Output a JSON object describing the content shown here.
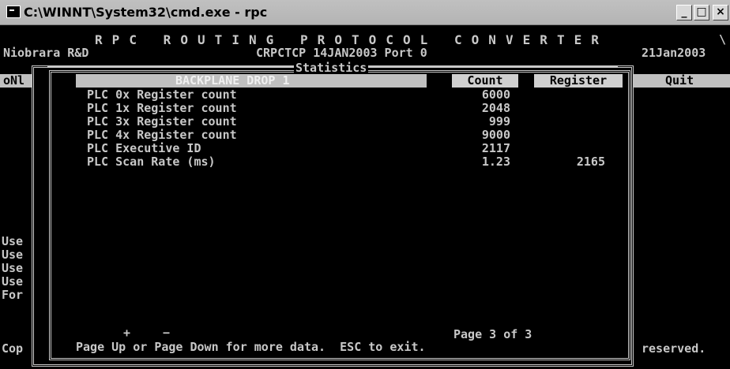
{
  "window": {
    "title": "C:\\WINNT\\System32\\cmd.exe - rpc",
    "minimize_label": "_",
    "maximize_label": "□",
    "close_label": "×"
  },
  "header": {
    "title": "R P C   R O U T I N G   P R O T O C O L   C O N V E R T E R",
    "company": "Niobrara R&D",
    "subtitle": "CRPCTCP 14JAN2003 Port 0",
    "date": "21Jan2003",
    "corner_mark": "\\"
  },
  "background": {
    "menu_left": "oNl",
    "menu_right": "Quit",
    "use_lines": [
      "Use",
      "Use",
      "Use",
      "Use",
      "For"
    ],
    "copyright_left": "Cop",
    "copyright_right": "reserved."
  },
  "statistics": {
    "box_title": "Statistics",
    "section_header": "BACKPLANE DROP 1",
    "count_header": "Count",
    "register_header": "Register",
    "rows": [
      {
        "label": "PLC 0x Register count",
        "count": "6000",
        "register": ""
      },
      {
        "label": "PLC 1x Register count",
        "count": "2048",
        "register": ""
      },
      {
        "label": "PLC 3x Register count",
        "count": "999",
        "register": ""
      },
      {
        "label": "PLC 4x Register count",
        "count": "9000",
        "register": ""
      },
      {
        "label": "PLC Executive ID",
        "count": "2117",
        "register": ""
      },
      {
        "label": "PLC Scan Rate (ms)",
        "count": "1.23",
        "register": "2165"
      }
    ],
    "plus_symbol": "+",
    "minus_symbol": "−",
    "page_indicator": "Page 3 of 3",
    "footer_hint": "Page Up or Page Down for more data.  ESC to exit."
  }
}
